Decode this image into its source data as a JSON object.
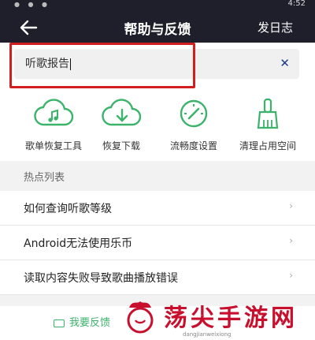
{
  "status": {
    "time": "4:52"
  },
  "header": {
    "title": "帮助与反馈",
    "right_action": "发日志"
  },
  "search": {
    "value": "听歌报告"
  },
  "tools": [
    {
      "label": "歌单恢复工具",
      "icon": "cloud-music-icon"
    },
    {
      "label": "恢复下载",
      "icon": "cloud-download-icon"
    },
    {
      "label": "流畅度设置",
      "icon": "gauge-icon"
    },
    {
      "label": "清理占用空间",
      "icon": "brush-icon"
    }
  ],
  "hot": {
    "title": "热点列表",
    "items": [
      {
        "label": "如何查询听歌等级"
      },
      {
        "label": "Android无法使用乐币"
      },
      {
        "label": "读取内容失败导致歌曲播放错误"
      }
    ]
  },
  "footer": {
    "feedback_label": "我要反馈"
  },
  "watermark": {
    "text": "荡尖手游网",
    "url": "dangjianweixiong"
  },
  "colors": {
    "header_bg": "#1f1f2b",
    "accent": "#3bb36a",
    "highlight": "#d11f1f"
  }
}
